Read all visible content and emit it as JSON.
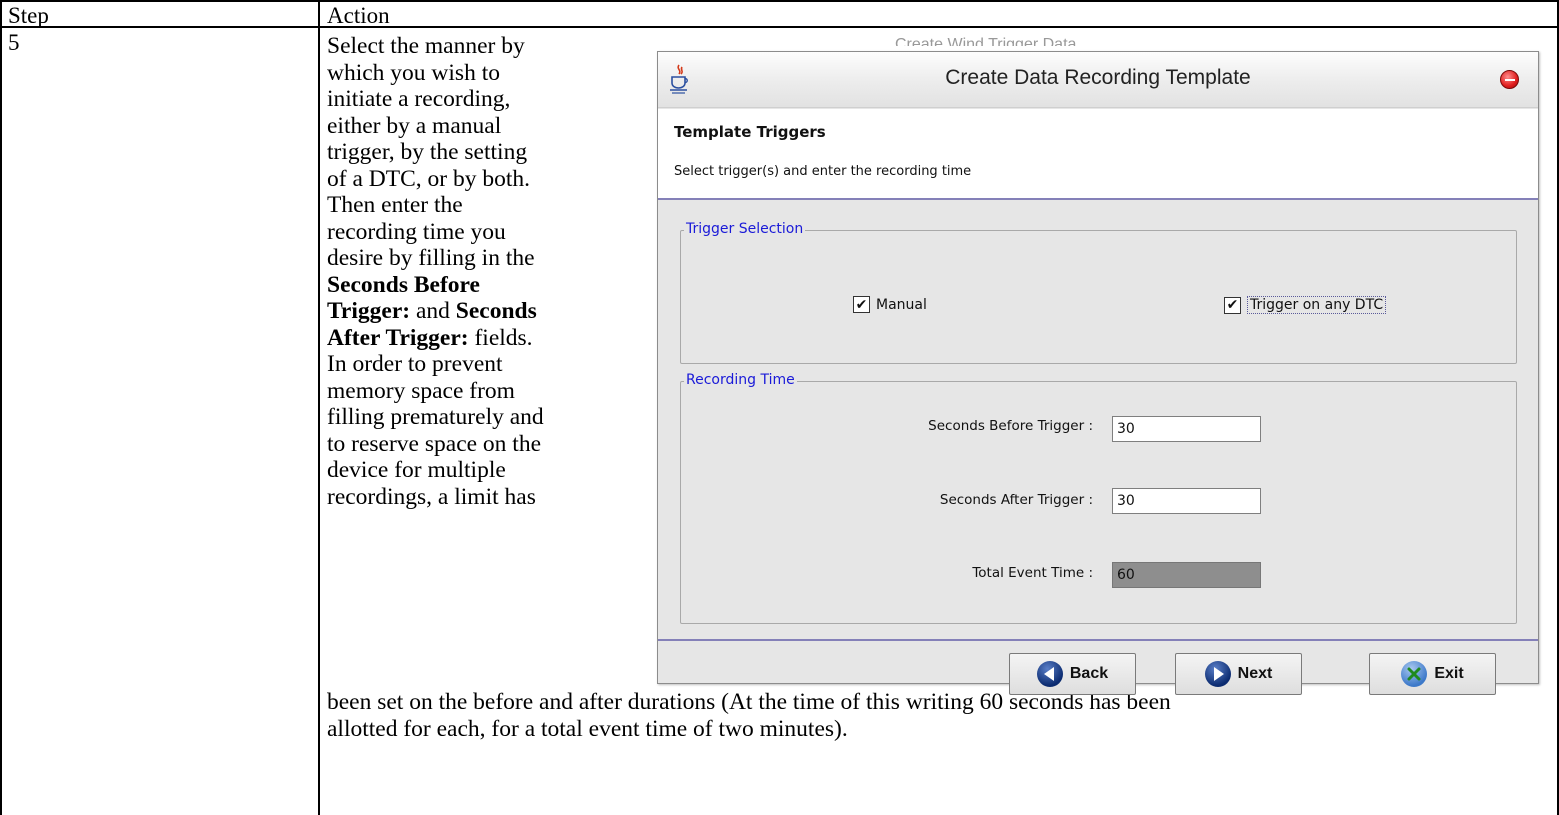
{
  "table": {
    "header_step": "Step",
    "header_action": "Action",
    "step_number": "5",
    "lines_side": [
      {
        "pre": "Select the manner by"
      },
      {
        "pre": "which you wish to"
      },
      {
        "pre": "initiate a recording,"
      },
      {
        "pre": "either by a manual"
      },
      {
        "pre": "trigger, by the setting"
      },
      {
        "pre": "of a DTC, or by both."
      },
      {
        "pre": "Then enter the"
      },
      {
        "pre": "recording time you"
      },
      {
        "pre": "desire by filling in the"
      },
      {
        "bold": "Seconds Before"
      },
      {
        "bold": "Trigger:",
        "post": " and ",
        "bold2": "Seconds"
      },
      {
        "bold": "After Trigger:",
        "post": " fields."
      },
      {
        "pre": "In order to prevent"
      },
      {
        "pre": "memory space from"
      },
      {
        "pre": "filling prematurely and"
      },
      {
        "pre": "to reserve space on the"
      },
      {
        "pre": "device for multiple"
      },
      {
        "pre": "recordings, a limit has"
      }
    ],
    "lines_full": [
      "been set on the before and after durations (At the time of this writing 60 seconds has been",
      "allotted for each, for a total event time of two minutes)."
    ],
    "ghost_text": "Create Wind Trigger Data"
  },
  "dialog": {
    "title": "Create Data Recording Template",
    "header_title": "Template Triggers",
    "header_subtitle": "Select trigger(s) and enter the recording time",
    "trigger_group": {
      "legend": "Trigger Selection",
      "manual": {
        "label": "Manual",
        "checked": true
      },
      "dtc": {
        "label": "Trigger on any DTC",
        "checked": true
      }
    },
    "time_group": {
      "legend": "Recording Time",
      "before_label": "Seconds Before Trigger :",
      "before_value": "30",
      "after_label": "Seconds After Trigger :",
      "after_value": "30",
      "total_label": "Total Event Time :",
      "total_value": "60"
    },
    "buttons": {
      "back": "Back",
      "next": "Next",
      "exit": "Exit"
    },
    "check_glyph": "✔",
    "colors": {
      "legend": "#1a1ad8",
      "separator": "#8480b8",
      "close": "#e01d1d"
    }
  }
}
